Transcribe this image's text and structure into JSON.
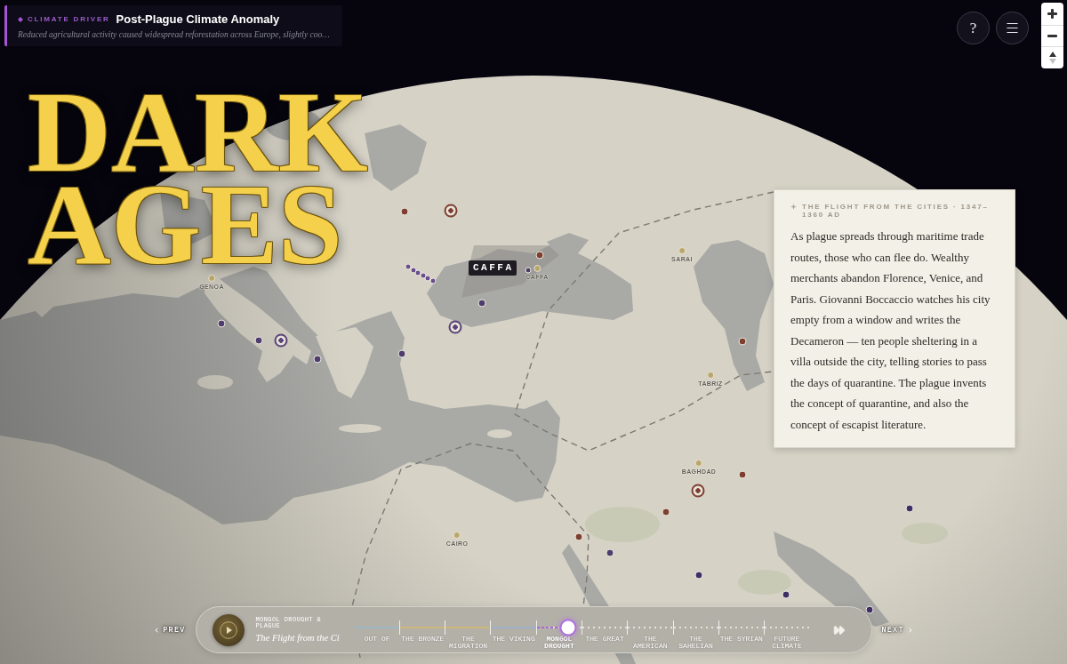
{
  "driver_card": {
    "label": "CLIMATE DRIVER",
    "title": "Post-Plague Climate Anomaly",
    "summary": "Reduced agricultural activity caused widespread reforestation across Europe, slightly coo…"
  },
  "top_controls": {
    "help": "?"
  },
  "title": "DARK AGES",
  "map": {
    "callout": "CAFFA",
    "cities": [
      {
        "name": "GENOA"
      },
      {
        "name": "CAFFA"
      },
      {
        "name": "SARAI"
      },
      {
        "name": "TABRIZ"
      },
      {
        "name": "BAGHDAD"
      },
      {
        "name": "CAIRO"
      }
    ],
    "markers": [
      {
        "kind": "dot",
        "color": "#7e3f31"
      },
      {
        "kind": "ring",
        "color": "#7e3f31"
      },
      {
        "kind": "dot",
        "color": "#7e3f31"
      },
      {
        "kind": "small",
        "color": "#6b4f8c"
      },
      {
        "kind": "small",
        "color": "#6b4f8c"
      },
      {
        "kind": "small",
        "color": "#6b4f8c"
      },
      {
        "kind": "small",
        "color": "#6b4f8c"
      },
      {
        "kind": "small",
        "color": "#6b4f8c"
      },
      {
        "kind": "small",
        "color": "#6b4f8c"
      },
      {
        "kind": "small",
        "color": "#4f3d6e"
      },
      {
        "kind": "dot",
        "color": "#4f3d6e"
      },
      {
        "kind": "ring",
        "color": "#5a4478"
      },
      {
        "kind": "dot",
        "color": "#4f3d6e"
      },
      {
        "kind": "dot",
        "color": "#4f3d6e"
      },
      {
        "kind": "ring",
        "color": "#5a4478"
      },
      {
        "kind": "dot",
        "color": "#4f3d6e"
      },
      {
        "kind": "dot",
        "color": "#4f3d6e"
      },
      {
        "kind": "dot",
        "color": "#7e3f31"
      },
      {
        "kind": "dot",
        "color": "#7e3f31"
      },
      {
        "kind": "ring",
        "color": "#7e3f31"
      },
      {
        "kind": "dot",
        "color": "#7e3f31"
      },
      {
        "kind": "dot",
        "color": "#7e3f31"
      },
      {
        "kind": "dot",
        "color": "#4f3d6e"
      },
      {
        "kind": "dot",
        "color": "#3f2f66"
      },
      {
        "kind": "dot",
        "color": "#3f2f66"
      },
      {
        "kind": "dot",
        "color": "#3f2f66"
      },
      {
        "kind": "dot",
        "color": "#3f2f66"
      }
    ]
  },
  "story_card": {
    "heading": "THE FLIGHT FROM THE CITIES · 1347–1360 AD",
    "body": "As plague spreads through maritime trade routes, those who can flee do. Wealthy merchants abandon Florence, Venice, and Paris. Giovanni Boccaccio watches his city empty from a window and writes the Decameron — ten people sheltering in a villa outside the city, telling stories to pass the days of quarantine. The plague invents the concept of quarantine, and also the concept of escapist literature."
  },
  "player": {
    "prev": "PREV",
    "chapter": "MONGOL DROUGHT & PLAGUE",
    "story": "The Flight from the Ci",
    "level": 0.47,
    "eras": [
      {
        "label": "OUT OF",
        "color": "#9fb7c2",
        "selected": false
      },
      {
        "label": "THE BRONZE",
        "color": "#cdb77a",
        "selected": false
      },
      {
        "label": "THE MIGRATION",
        "color": "#cdb77a",
        "selected": false
      },
      {
        "label": "THE VIKING",
        "color": "#9fb0c8",
        "selected": false
      },
      {
        "label": "MONGOL DROUGHT",
        "color": "#a868d8",
        "selected": true
      },
      {
        "label": "THE GREAT",
        "color": "#e6e3dc",
        "selected": false
      },
      {
        "label": "THE AMERICAN",
        "color": "#e6e3dc",
        "selected": false
      },
      {
        "label": "THE SAHELIAN",
        "color": "#e6e3dc",
        "selected": false
      },
      {
        "label": "THE SYRIAN",
        "color": "#e6e3dc",
        "selected": false
      },
      {
        "label": "FUTURE CLIMATE",
        "color": "#e6e3dc",
        "selected": false
      }
    ],
    "next": "NEXT"
  }
}
